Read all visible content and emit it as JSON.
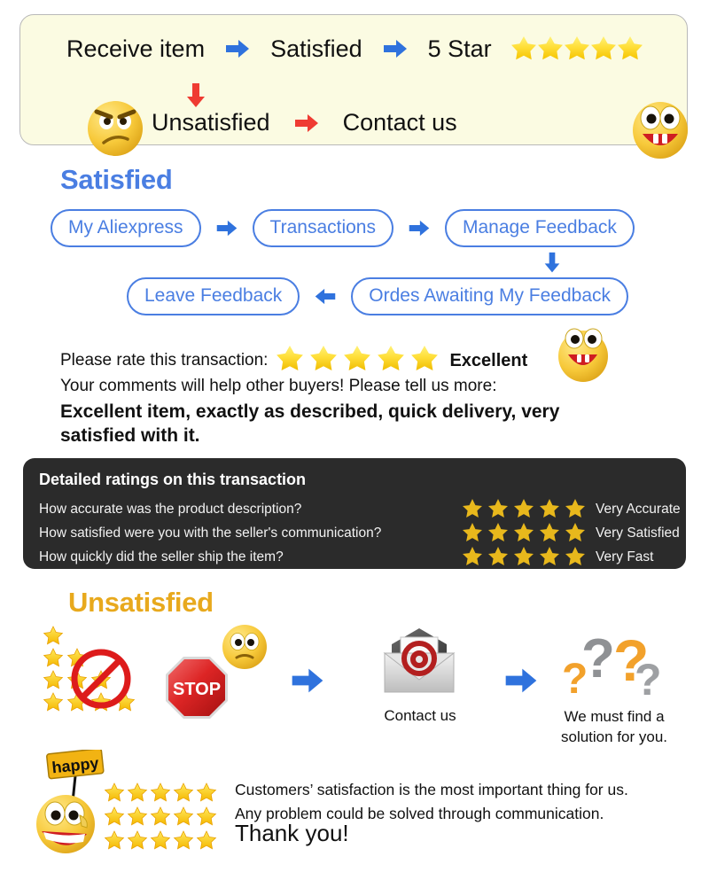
{
  "banner": {
    "row1": {
      "step1": "Receive item",
      "arrow1": "blue-right-arrow-icon",
      "step2": "Satisfied",
      "arrow2": "blue-right-arrow-icon",
      "step3": "5 Star",
      "stars": 5
    },
    "row2": {
      "down_arrow": "red-down-arrow-icon",
      "step1": "Unsatisfied",
      "arrow1": "red-right-arrow-icon",
      "step2": "Contact us"
    },
    "face_left": "angry-face-icon",
    "face_right": "happy-face-icon",
    "bg_color": "#fbfbe2",
    "border_color": "#b9b9b9"
  },
  "satisfied": {
    "heading": "Satisfied",
    "heading_color": "#4a7ee2",
    "flow_row1": [
      "My Aliexpress",
      "Transactions",
      "Manage Feedback"
    ],
    "flow_row2": [
      "Ordes Awaiting My Feedback",
      "Leave Feedback"
    ],
    "arrow_right": "blue-right-arrow-icon",
    "arrow_left": "blue-left-arrow-icon",
    "arrow_down": "blue-down-arrow-icon",
    "pill_color": "#4a7ee2"
  },
  "rating": {
    "prompt": "Please rate this transaction:",
    "stars": 5,
    "verdict": "Excellent",
    "comments_prompt": "Your comments will help other buyers! Please tell us more:",
    "comment_text": "Excellent item, exactly as described, quick delivery, very satisfied with it.",
    "face": "excited-face-icon"
  },
  "detailed_ratings": {
    "title": "Detailed ratings on this transaction",
    "bg_color": "#2b2b2b",
    "star_color": "#e8b81c",
    "rows": [
      {
        "question": "How accurate was the product description?",
        "stars": 5,
        "verdict": "Very Accurate"
      },
      {
        "question": "How satisfied were you with the seller's communication?",
        "stars": 5,
        "verdict": "Very Satisfied"
      },
      {
        "question": "How quickly did the seller ship the item?",
        "stars": 5,
        "verdict": "Very Fast"
      }
    ]
  },
  "unsatisfied": {
    "heading": "Unsatisfied",
    "heading_color": "#e8a91d",
    "star_pyramid_rows": [
      1,
      2,
      3,
      4
    ],
    "no_sign": "prohibition-icon",
    "stop_sign_label": "STOP",
    "face": "worried-face-icon",
    "arrow1": "blue-right-arrow-icon",
    "envelope": "email-envelope-icon",
    "contact_label": "Contact us",
    "arrow2": "blue-right-arrow-icon",
    "question_marks": "question-marks-icon",
    "solution_label": "We must find a solution for you."
  },
  "footer": {
    "sign_text": "happy",
    "face": "happy-face-with-sign-icon",
    "star_grid_rows": 3,
    "star_grid_cols": 5,
    "line1": "Customers’ satisfaction is the most important thing for us.",
    "line2": "Any problem could be solved through communication.",
    "thanks": "Thank you!"
  }
}
